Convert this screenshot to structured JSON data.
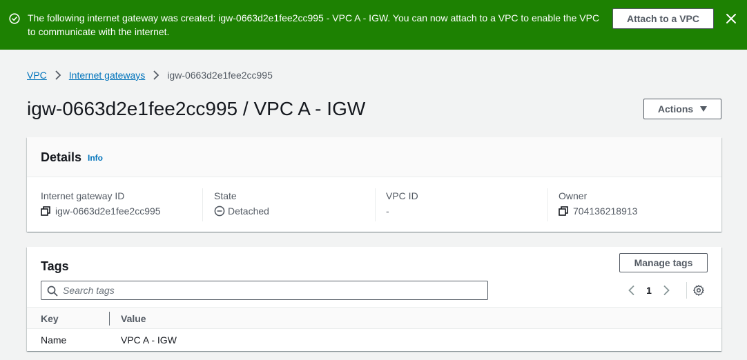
{
  "flash": {
    "message": "The following internet gateway was created: igw-0663d2e1fee2cc995 - VPC A - IGW. You can now attach to a VPC to enable the VPC to communicate with the internet.",
    "action_label": "Attach to a VPC",
    "icon": "success-check-icon",
    "close_icon": "close-icon",
    "background": "#1d8102"
  },
  "breadcrumb": {
    "items": [
      "VPC",
      "Internet gateways"
    ],
    "current": "igw-0663d2e1fee2cc995"
  },
  "page": {
    "title": "igw-0663d2e1fee2cc995 / VPC A - IGW",
    "actions_label": "Actions"
  },
  "details": {
    "heading": "Details",
    "info_link": "Info",
    "fields": [
      {
        "label": "Internet gateway ID",
        "value": "igw-0663d2e1fee2cc995",
        "icon": "copy-icon"
      },
      {
        "label": "State",
        "value": "Detached",
        "icon": "detached-status-icon"
      },
      {
        "label": "VPC ID",
        "value": "-"
      },
      {
        "label": "Owner",
        "value": "704136218913",
        "icon": "copy-icon"
      }
    ]
  },
  "tags": {
    "heading": "Tags",
    "manage_label": "Manage tags",
    "search_placeholder": "Search tags",
    "pagination": {
      "current_page": "1"
    },
    "columns": [
      "Key",
      "Value"
    ],
    "rows": [
      {
        "key": "Name",
        "value": "VPC A - IGW"
      }
    ]
  },
  "colors": {
    "link": "#0073bb",
    "text_secondary": "#545b64",
    "page_bg": "#f2f3f3"
  }
}
